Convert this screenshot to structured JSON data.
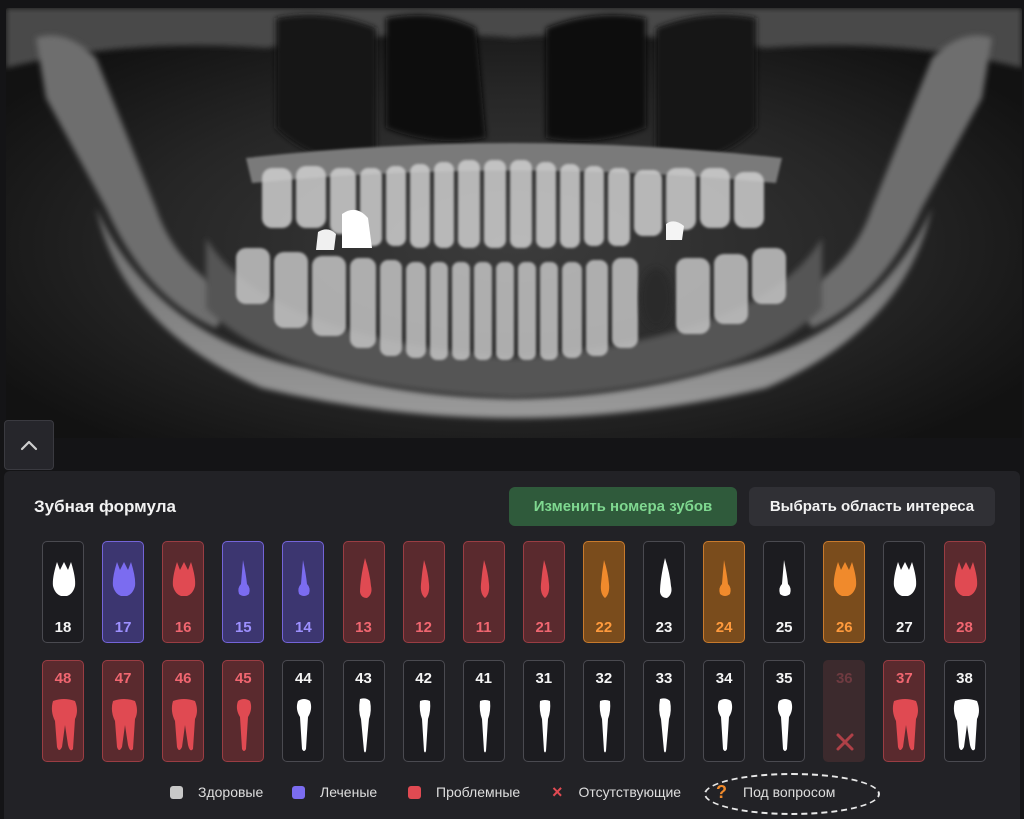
{
  "panel": {
    "title": "Зубная формула",
    "renumber_button": "Изменить номера зубов",
    "roi_button": "Выбрать область интереса"
  },
  "colors": {
    "healthy": "#c8c8c8",
    "treated": "#7b6cf0",
    "problem": "#e04a52",
    "missing": "#e04a52",
    "question": "#f08a2c",
    "renumber_text": "#7fd890"
  },
  "upper_teeth": [
    {
      "num": "18",
      "status": "healthy",
      "icon": "molar-icon"
    },
    {
      "num": "17",
      "status": "treated",
      "icon": "molar-icon"
    },
    {
      "num": "16",
      "status": "problem",
      "icon": "molar-icon"
    },
    {
      "num": "15",
      "status": "treated",
      "icon": "premolar-icon"
    },
    {
      "num": "14",
      "status": "treated",
      "icon": "premolar-icon"
    },
    {
      "num": "13",
      "status": "problem",
      "icon": "canine-icon"
    },
    {
      "num": "12",
      "status": "problem",
      "icon": "incisor-icon"
    },
    {
      "num": "11",
      "status": "problem",
      "icon": "incisor-icon"
    },
    {
      "num": "21",
      "status": "problem",
      "icon": "incisor-icon"
    },
    {
      "num": "22",
      "status": "question",
      "icon": "incisor-icon"
    },
    {
      "num": "23",
      "status": "healthy",
      "icon": "canine-icon"
    },
    {
      "num": "24",
      "status": "question",
      "icon": "premolar-icon"
    },
    {
      "num": "25",
      "status": "healthy",
      "icon": "premolar-icon"
    },
    {
      "num": "26",
      "status": "question",
      "icon": "molar-icon"
    },
    {
      "num": "27",
      "status": "healthy",
      "icon": "molar-icon"
    },
    {
      "num": "28",
      "status": "problem",
      "icon": "molar-icon"
    }
  ],
  "lower_teeth": [
    {
      "num": "48",
      "status": "problem",
      "icon": "molar-icon"
    },
    {
      "num": "47",
      "status": "problem",
      "icon": "molar-icon"
    },
    {
      "num": "46",
      "status": "problem",
      "icon": "molar-icon"
    },
    {
      "num": "45",
      "status": "problem",
      "icon": "premolar-icon"
    },
    {
      "num": "44",
      "status": "healthy",
      "icon": "premolar-icon"
    },
    {
      "num": "43",
      "status": "healthy",
      "icon": "canine-icon"
    },
    {
      "num": "42",
      "status": "healthy",
      "icon": "incisor-icon"
    },
    {
      "num": "41",
      "status": "healthy",
      "icon": "incisor-icon"
    },
    {
      "num": "31",
      "status": "healthy",
      "icon": "incisor-icon"
    },
    {
      "num": "32",
      "status": "healthy",
      "icon": "incisor-icon"
    },
    {
      "num": "33",
      "status": "healthy",
      "icon": "canine-icon"
    },
    {
      "num": "34",
      "status": "healthy",
      "icon": "premolar-icon"
    },
    {
      "num": "35",
      "status": "healthy",
      "icon": "premolar-icon"
    },
    {
      "num": "36",
      "status": "missing",
      "icon": "missing-x-icon"
    },
    {
      "num": "37",
      "status": "problem",
      "icon": "molar-icon"
    },
    {
      "num": "38",
      "status": "healthy",
      "icon": "molar-icon"
    }
  ],
  "legend": [
    {
      "label": "Здоровые",
      "marker": "square",
      "color": "#c8c8c8"
    },
    {
      "label": "Леченые",
      "marker": "square",
      "color": "#7b6cf0"
    },
    {
      "label": "Проблемные",
      "marker": "square",
      "color": "#e04a52"
    },
    {
      "label": "Отсутствующие",
      "marker": "×",
      "color": "#e04a52"
    },
    {
      "label": "Под вопросом",
      "marker": "?",
      "color": "#f08a2c"
    }
  ]
}
